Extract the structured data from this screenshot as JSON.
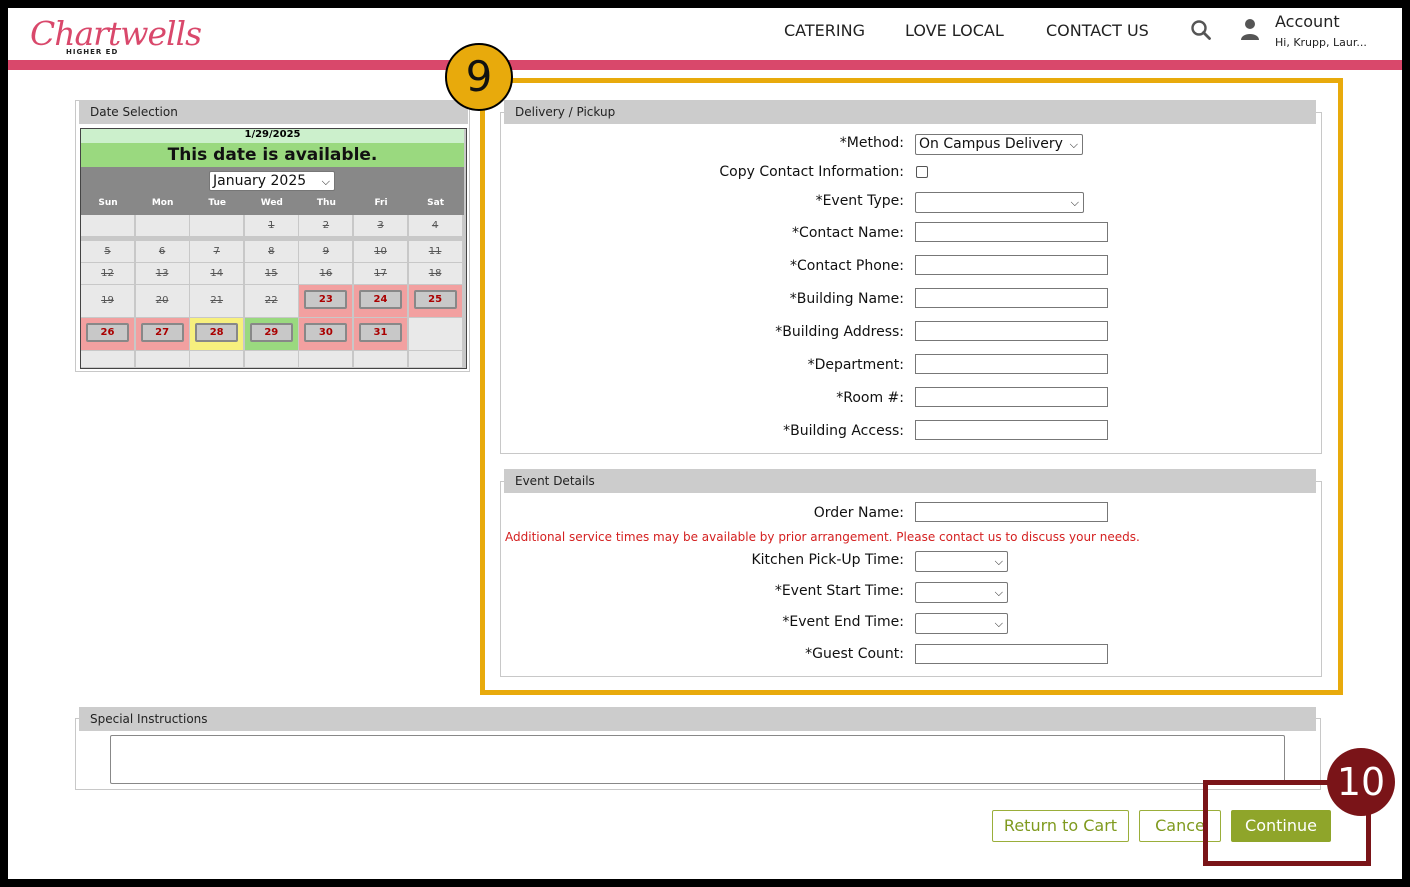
{
  "header": {
    "logo_script": "Chartwells",
    "logo_sub": "HIGHER ED",
    "nav": [
      "CATERING",
      "LOVE LOCAL",
      "CONTACT US"
    ],
    "account_title": "Account",
    "account_sub": "Hi, Krupp, Laur...",
    "brand_color": "#d9486b"
  },
  "date_selection": {
    "title": "Date Selection",
    "selected_date": "1/29/2025",
    "availability": "This date is available.",
    "month_select": "January 2025",
    "weekdays": [
      "Sun",
      "Mon",
      "Tue",
      "Wed",
      "Thu",
      "Fri",
      "Sat"
    ],
    "weeks": [
      [
        "",
        "",
        "",
        "1",
        "2",
        "3",
        "4"
      ],
      [
        "5",
        "6",
        "7",
        "8",
        "9",
        "10",
        "11"
      ],
      [
        "12",
        "13",
        "14",
        "15",
        "16",
        "17",
        "18"
      ],
      [
        "19",
        "20",
        "21",
        "22",
        "23",
        "24",
        "25"
      ],
      [
        "26",
        "27",
        "28",
        "29",
        "30",
        "31",
        ""
      ]
    ]
  },
  "delivery": {
    "title": "Delivery / Pickup",
    "method_label": "*Method:",
    "method_value": "On Campus Delivery",
    "copy_contact_label": "Copy Contact Information:",
    "event_type_label": "*Event Type:",
    "contact_name_label": "*Contact Name:",
    "contact_phone_label": "*Contact Phone:",
    "building_name_label": "*Building Name:",
    "building_address_label": "*Building Address:",
    "department_label": "*Department:",
    "room_label": "*Room #:",
    "building_access_label": "*Building Access:"
  },
  "event_details": {
    "title": "Event Details",
    "order_name_label": "Order Name:",
    "notice": "Additional service times may be available by prior arrangement. Please contact us to discuss your needs.",
    "kitchen_pickup_label": "Kitchen Pick-Up Time:",
    "event_start_label": "*Event Start Time:",
    "event_end_label": "*Event End Time:",
    "guest_count_label": "*Guest Count:"
  },
  "special_instructions": {
    "title": "Special Instructions"
  },
  "buttons": {
    "return_to_cart": "Return to Cart",
    "cancel": "Cance",
    "continue": "Continue"
  },
  "callouts": {
    "step9": "9",
    "step10": "10",
    "step9_color": "#e8aa0c",
    "step10_color": "#7a1418"
  }
}
